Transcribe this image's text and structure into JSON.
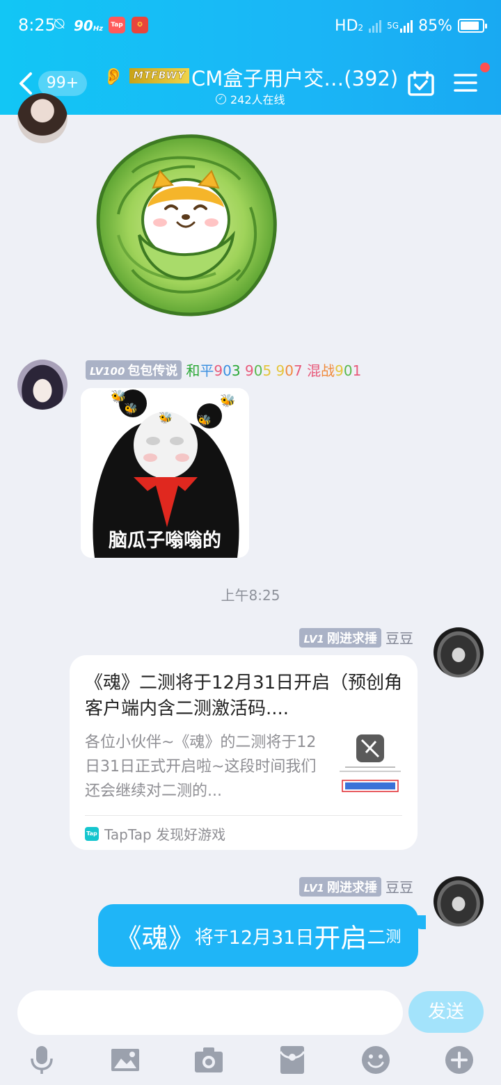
{
  "status_bar": {
    "time": "8:25",
    "refresh_rate": "90",
    "refresh_unit": "Hz",
    "app1": "Tap",
    "network": "HD",
    "network_sub": "2",
    "net_type": "5G",
    "battery": "85%"
  },
  "header": {
    "unread_badge": "99+",
    "group_tag": "MTFBWY",
    "title": "CM盒子用户交…(392)",
    "online_text": "242人在线"
  },
  "colors": {
    "header_gradient": [
      "#12c6f5",
      "#19a9f2"
    ],
    "bubble_blue": "#1fb5f7",
    "send_button": "#a3e3fb",
    "chat_bg": "#eef0f6"
  },
  "messages": [
    {
      "type": "sticker",
      "sender": "left",
      "sticker": "cabbage-shiba-sticker"
    },
    {
      "type": "image",
      "sender": "left",
      "level": "LV100",
      "rank": "包包传说",
      "titles": [
        {
          "text": "和",
          "color": "#2aa836"
        },
        {
          "text": "平",
          "color": "#3a8fe0"
        },
        {
          "text": "9",
          "color": "#e85a7a"
        },
        {
          "text": "0",
          "color": "#3a8fe0"
        },
        {
          "text": "3",
          "color": "#2aa836"
        },
        {
          "text": " 9",
          "color": "#e85a7a"
        },
        {
          "text": "0",
          "color": "#58b94b"
        },
        {
          "text": "5",
          "color": "#e5c53b"
        },
        {
          "text": " 9",
          "color": "#e5c53b"
        },
        {
          "text": "0",
          "color": "#f08a3c"
        },
        {
          "text": "7",
          "color": "#e85a7a"
        },
        {
          "text": " 混",
          "color": "#e85a7a"
        },
        {
          "text": "战",
          "color": "#f08a3c"
        },
        {
          "text": "9",
          "color": "#e5c53b"
        },
        {
          "text": "0",
          "color": "#58b94b"
        },
        {
          "text": "1",
          "color": "#e85a7a"
        }
      ],
      "caption": "脑瓜子嗡嗡的"
    }
  ],
  "timestamp": "上午8:25",
  "link_message": {
    "level": "LV1",
    "rank": "刚进求捶",
    "sender_name": "豆豆",
    "title": "《魂》二测将于12月31日开启（预创角客户端内含二测激活码....",
    "description": "各位小伙伴~《魂》的二测将于12日31日正式开启啦~这段时间我们还会继续对二测的...",
    "source": "TapTap 发现好游戏",
    "source_icon": "Tap"
  },
  "text_message": {
    "level": "LV1",
    "rank": "刚进求捶",
    "sender_name": "豆豆",
    "parts": [
      {
        "text": "《魂》",
        "size": "big"
      },
      {
        "text": "将",
        "size": "mid"
      },
      {
        "text": "于",
        "size": "sm"
      },
      {
        "text": "12月31日",
        "size": "mid"
      },
      {
        "text": "开启",
        "size": "big"
      },
      {
        "text": "二",
        "size": "mid"
      },
      {
        "text": "测",
        "size": "sm"
      }
    ]
  },
  "input": {
    "placeholder": "",
    "send_label": "发送"
  },
  "toolbar": [
    "mic-icon",
    "image-icon",
    "camera-icon",
    "red-packet-icon",
    "emoji-icon",
    "plus-icon"
  ]
}
